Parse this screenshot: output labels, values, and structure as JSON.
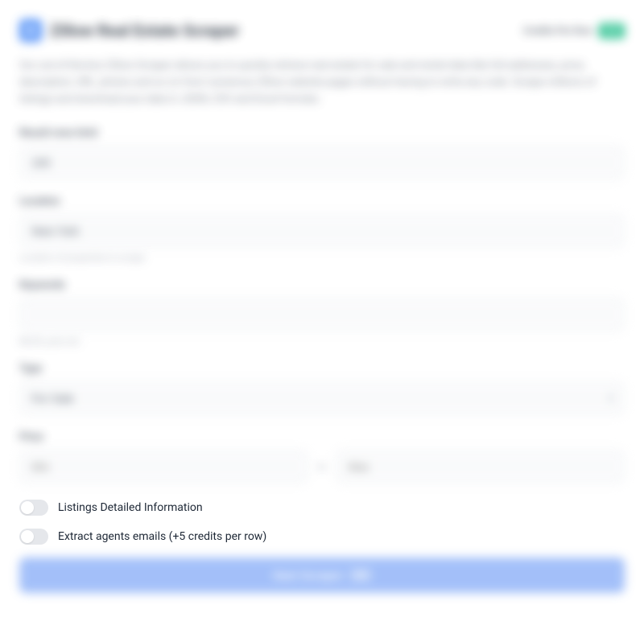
{
  "header": {
    "title": "Zillow Real Estate Scraper",
    "credits_label": "Credits Per Row",
    "credits_value": "0.8"
  },
  "description": "Our out-of-the-box Zillow Scraper allows you to quickly retrieve real estate for sale and rental data like full addresses, price, description, URL, photos and so on from numerous Zillow website pages without having to write any code. Scrape millions of listings and download your data in JSON, CSV and Excel formats.",
  "fields": {
    "result_limit": {
      "label": "Result rows limit",
      "value": "100"
    },
    "location": {
      "label": "Location",
      "value": "New York",
      "helper": "Location of properties to scrape"
    },
    "keywords": {
      "label": "Keywords",
      "value": "",
      "helper": "MLS#, yard, etc."
    },
    "type": {
      "label": "Type",
      "value": "For Sale"
    },
    "price": {
      "label": "Price",
      "from_placeholder": "Min",
      "to_placeholder": "Max",
      "separator": "to"
    }
  },
  "toggles": {
    "detailed": "Listings Detailed Information",
    "agents_emails": "Extract agents emails (+5 credits per row)"
  },
  "submit": {
    "label": "Start Scraper",
    "badge": "0.8"
  }
}
